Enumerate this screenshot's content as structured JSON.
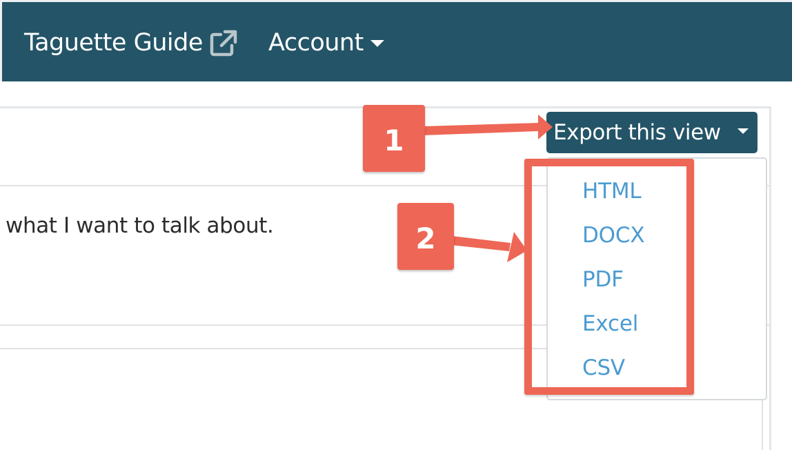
{
  "navbar": {
    "guide_label": "Taguette Guide",
    "guide_icon": "external-link-icon",
    "account_label": "Account",
    "background": "#245467"
  },
  "document": {
    "text": "what I want to talk about."
  },
  "export": {
    "button_label": "Export this view",
    "menu_items": [
      "HTML",
      "DOCX",
      "PDF",
      "Excel",
      "CSV"
    ],
    "link_color": "#4b9bd1"
  },
  "annotations": {
    "step1": "1",
    "step2": "2",
    "color": "#ee6655"
  }
}
